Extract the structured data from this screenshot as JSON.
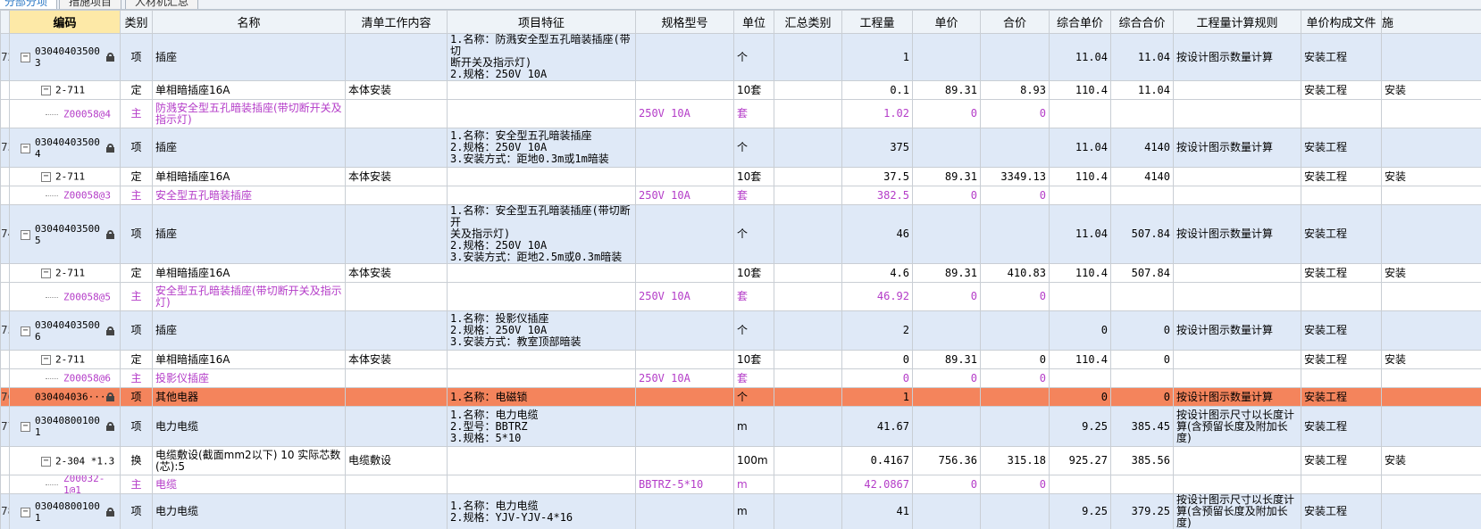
{
  "tabs": {
    "left": "分部分项",
    "mid": "措施项目",
    "right": "人材机汇总"
  },
  "headers": {
    "code": "编码",
    "type": "类别",
    "name": "名称",
    "content": "清单工作内容",
    "feature": "项目特征",
    "spec": "规格型号",
    "unit": "单位",
    "summary": "汇总类别",
    "qty": "工程量",
    "price": "单价",
    "total": "合价",
    "comp_price": "综合单价",
    "comp_total": "综合合价",
    "rule": "工程量计算规则",
    "file": "单价构成文件",
    "extra": "施"
  },
  "rows": [
    {
      "rn": "72",
      "code": "03040403500\n3",
      "type": "项",
      "name": "插座",
      "content": "",
      "feature": "1.名称：防溅安全型五孔暗装插座(带切\n断开关及指示灯)\n2.规格：250V 10A",
      "spec": "",
      "unit": "个",
      "summary": "",
      "qty": "1",
      "price": "",
      "total": "",
      "cprice": "11.04",
      "ctotal": "11.04",
      "rule": "按设计图示数量计算",
      "file": "安装工程",
      "extra": ""
    },
    {
      "rn": "",
      "code": "2-711",
      "type": "定",
      "name": "单相暗插座16A",
      "content": "本体安装",
      "feature": "",
      "spec": "",
      "unit": "10套",
      "summary": "",
      "qty": "0.1",
      "price": "89.31",
      "total": "8.93",
      "cprice": "110.4",
      "ctotal": "11.04",
      "rule": "",
      "file": "安装工程",
      "extra": "安装"
    },
    {
      "rn": "",
      "code": "Z00058@4",
      "type": "主",
      "name": "防溅安全型五孔暗装插座(带切断开关及指示灯)",
      "content": "",
      "feature": "",
      "spec": "250V 10A",
      "unit": "套",
      "summary": "",
      "qty": "1.02",
      "price": "0",
      "total": "0",
      "cprice": "",
      "ctotal": "",
      "rule": "",
      "file": "",
      "extra": ""
    },
    {
      "rn": "73",
      "code": "03040403500\n4",
      "type": "项",
      "name": "插座",
      "content": "",
      "feature": "1.名称：安全型五孔暗装插座\n2.规格：250V 10A\n3.安装方式：距地0.3m或1m暗装",
      "spec": "",
      "unit": "个",
      "summary": "",
      "qty": "375",
      "price": "",
      "total": "",
      "cprice": "11.04",
      "ctotal": "4140",
      "rule": "按设计图示数量计算",
      "file": "安装工程",
      "extra": ""
    },
    {
      "rn": "",
      "code": "2-711",
      "type": "定",
      "name": "单相暗插座16A",
      "content": "本体安装",
      "feature": "",
      "spec": "",
      "unit": "10套",
      "summary": "",
      "qty": "37.5",
      "price": "89.31",
      "total": "3349.13",
      "cprice": "110.4",
      "ctotal": "4140",
      "rule": "",
      "file": "安装工程",
      "extra": "安装"
    },
    {
      "rn": "",
      "code": "Z00058@3",
      "type": "主",
      "name": "安全型五孔暗装插座",
      "content": "",
      "feature": "",
      "spec": "250V 10A",
      "unit": "套",
      "summary": "",
      "qty": "382.5",
      "price": "0",
      "total": "0",
      "cprice": "",
      "ctotal": "",
      "rule": "",
      "file": "",
      "extra": ""
    },
    {
      "rn": "74",
      "code": "03040403500\n5",
      "type": "项",
      "name": "插座",
      "content": "",
      "feature": "1.名称：安全型五孔暗装插座(带切断开\n关及指示灯)\n2.规格：250V 10A\n3.安装方式：距地2.5m或0.3m暗装",
      "spec": "",
      "unit": "个",
      "summary": "",
      "qty": "46",
      "price": "",
      "total": "",
      "cprice": "11.04",
      "ctotal": "507.84",
      "rule": "按设计图示数量计算",
      "file": "安装工程",
      "extra": ""
    },
    {
      "rn": "",
      "code": "2-711",
      "type": "定",
      "name": "单相暗插座16A",
      "content": "本体安装",
      "feature": "",
      "spec": "",
      "unit": "10套",
      "summary": "",
      "qty": "4.6",
      "price": "89.31",
      "total": "410.83",
      "cprice": "110.4",
      "ctotal": "507.84",
      "rule": "",
      "file": "安装工程",
      "extra": "安装"
    },
    {
      "rn": "",
      "code": "Z00058@5",
      "type": "主",
      "name": "安全型五孔暗装插座(带切断开关及指示灯)",
      "content": "",
      "feature": "",
      "spec": "250V 10A",
      "unit": "套",
      "summary": "",
      "qty": "46.92",
      "price": "0",
      "total": "0",
      "cprice": "",
      "ctotal": "",
      "rule": "",
      "file": "",
      "extra": ""
    },
    {
      "rn": "75",
      "code": "03040403500\n6",
      "type": "项",
      "name": "插座",
      "content": "",
      "feature": "1.名称：投影仪插座\n2.规格：250V 10A\n3.安装方式：教室顶部暗装",
      "spec": "",
      "unit": "个",
      "summary": "",
      "qty": "2",
      "price": "",
      "total": "",
      "cprice": "0",
      "ctotal": "0",
      "rule": "按设计图示数量计算",
      "file": "安装工程",
      "extra": ""
    },
    {
      "rn": "",
      "code": "2-711",
      "type": "定",
      "name": "单相暗插座16A",
      "content": "本体安装",
      "feature": "",
      "spec": "",
      "unit": "10套",
      "summary": "",
      "qty": "0",
      "price": "89.31",
      "total": "0",
      "cprice": "110.4",
      "ctotal": "0",
      "rule": "",
      "file": "安装工程",
      "extra": "安装"
    },
    {
      "rn": "",
      "code": "Z00058@6",
      "type": "主",
      "name": "投影仪插座",
      "content": "",
      "feature": "",
      "spec": "250V  10A",
      "unit": "套",
      "summary": "",
      "qty": "0",
      "price": "0",
      "total": "0",
      "cprice": "",
      "ctotal": "",
      "rule": "",
      "file": "",
      "extra": ""
    },
    {
      "rn": "76",
      "code": "030404036···",
      "type": "项",
      "name": "其他电器",
      "content": "",
      "feature": "1.名称：电磁锁",
      "spec": "",
      "unit": "个",
      "summary": "",
      "qty": "1",
      "price": "",
      "total": "",
      "cprice": "0",
      "ctotal": "0",
      "rule": "按设计图示数量计算",
      "file": "安装工程",
      "extra": ""
    },
    {
      "rn": "77",
      "code": "03040800100\n1",
      "type": "项",
      "name": "电力电缆",
      "content": "",
      "feature": "1.名称：电力电缆\n2.型号：BBTRZ\n3.规格：5*10",
      "spec": "",
      "unit": "m",
      "summary": "",
      "qty": "41.67",
      "price": "",
      "total": "",
      "cprice": "9.25",
      "ctotal": "385.45",
      "rule": "按设计图示尺寸以长度计算(含预留长度及附加长度)",
      "file": "安装工程",
      "extra": ""
    },
    {
      "rn": "",
      "code": "2-304 *1.3",
      "type": "换",
      "name": "电缆敷设(截面mm2以下) 10  实际芯数(芯):5",
      "content": "电缆敷设",
      "feature": "",
      "spec": "",
      "unit": "100m",
      "summary": "",
      "qty": "0.4167",
      "price": "756.36",
      "total": "315.18",
      "cprice": "925.27",
      "ctotal": "385.56",
      "rule": "",
      "file": "安装工程",
      "extra": "安装"
    },
    {
      "rn": "",
      "code": "Z00032-1@1",
      "type": "主",
      "name": "电缆",
      "content": "",
      "feature": "",
      "spec": "BBTRZ-5*10",
      "unit": "m",
      "summary": "",
      "qty": "42.0867",
      "price": "0",
      "total": "0",
      "cprice": "",
      "ctotal": "",
      "rule": "",
      "file": "",
      "extra": ""
    },
    {
      "rn": "78",
      "code": "03040800100\n1",
      "type": "项",
      "name": "电力电缆",
      "content": "",
      "feature": "1.名称：电力电缆\n2.规格：YJV-YJV-4*16",
      "spec": "",
      "unit": "m",
      "summary": "",
      "qty": "41",
      "price": "",
      "total": "",
      "cprice": "9.25",
      "ctotal": "379.25",
      "rule": "按设计图示尺寸以长度计算(含预留长度及附加长度)",
      "file": "安装工程",
      "extra": ""
    }
  ],
  "colors": {
    "selected_row": "#f4845c",
    "item_row": "#dfe9f7",
    "material_text": "#b43cc8",
    "header_highlight": "#fde9a7"
  }
}
